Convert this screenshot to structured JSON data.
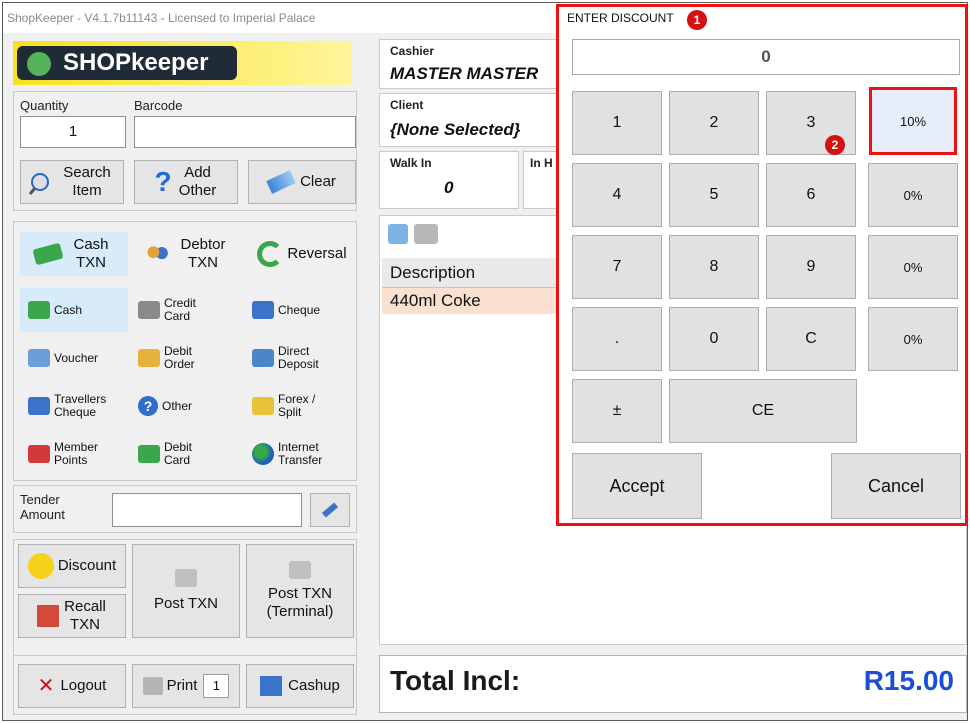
{
  "window": {
    "title": "ShopKeeper - V4.1.7b11143 - Licensed to Imperial Palace"
  },
  "logo": {
    "text": "SHOPkeeper"
  },
  "entry": {
    "quantity_label": "Quantity",
    "quantity_value": "1",
    "barcode_label": "Barcode",
    "barcode_value": "",
    "search_item": "Search Item",
    "add_other": "Add Other",
    "clear": "Clear"
  },
  "txn_types": [
    {
      "label": "Cash TXN",
      "icon": "cash-icon"
    },
    {
      "label": "Debtor TXN",
      "icon": "people-icon"
    },
    {
      "label": "Reversal",
      "icon": "reversal-icon"
    }
  ],
  "payment_methods": [
    {
      "label": "Cash",
      "icon": "cash-icon"
    },
    {
      "label": "Credit Card",
      "icon": "credit-card-icon"
    },
    {
      "label": "Cheque",
      "icon": "cheque-icon"
    },
    {
      "label": "Voucher",
      "icon": "voucher-icon"
    },
    {
      "label": "Debit Order",
      "icon": "debit-order-icon"
    },
    {
      "label": "Direct Deposit",
      "icon": "direct-deposit-icon"
    },
    {
      "label": "Travellers Cheque",
      "icon": "travellers-cheque-icon"
    },
    {
      "label": "Other",
      "icon": "question-icon"
    },
    {
      "label": "Forex / Split",
      "icon": "forex-icon"
    },
    {
      "label": "Member Points",
      "icon": "member-points-icon"
    },
    {
      "label": "Debit Card",
      "icon": "debit-card-icon"
    },
    {
      "label": "Internet Transfer",
      "icon": "globe-icon"
    }
  ],
  "tender": {
    "label": "Tender Amount",
    "value": ""
  },
  "actions": {
    "discount": "Discount",
    "recall": "Recall TXN",
    "post_txn": "Post TXN",
    "post_txn_terminal": "Post TXN (Terminal)"
  },
  "footer": {
    "logout": "Logout",
    "print": "Print",
    "print_copies": "1",
    "cashup": "Cashup"
  },
  "sale": {
    "cashier_label": "Cashier",
    "cashier_value": "MASTER MASTER",
    "client_label": "Client",
    "client_value": "{None Selected}",
    "walk_in_label": "Walk In",
    "walk_in_value": "0",
    "in_h_label": "In H",
    "description_header": "Description",
    "items": [
      "440ml Coke"
    ],
    "total_label": "Total Incl:",
    "total_value": "R15.00"
  },
  "dialog": {
    "title": "ENTER DISCOUNT",
    "display": "0",
    "badge_1": "1",
    "badge_2": "2",
    "keys": [
      "1",
      "2",
      "3",
      "4",
      "5",
      "6",
      "7",
      "8",
      "9",
      ".",
      "0",
      "C",
      "±",
      "CE"
    ],
    "presets": [
      "10%",
      "0%",
      "0%",
      "0%"
    ],
    "accept": "Accept",
    "cancel": "Cancel"
  },
  "colors": {
    "highlight": "#ee1111",
    "total": "#1a4fd1",
    "selected": "#d7ebfb"
  }
}
